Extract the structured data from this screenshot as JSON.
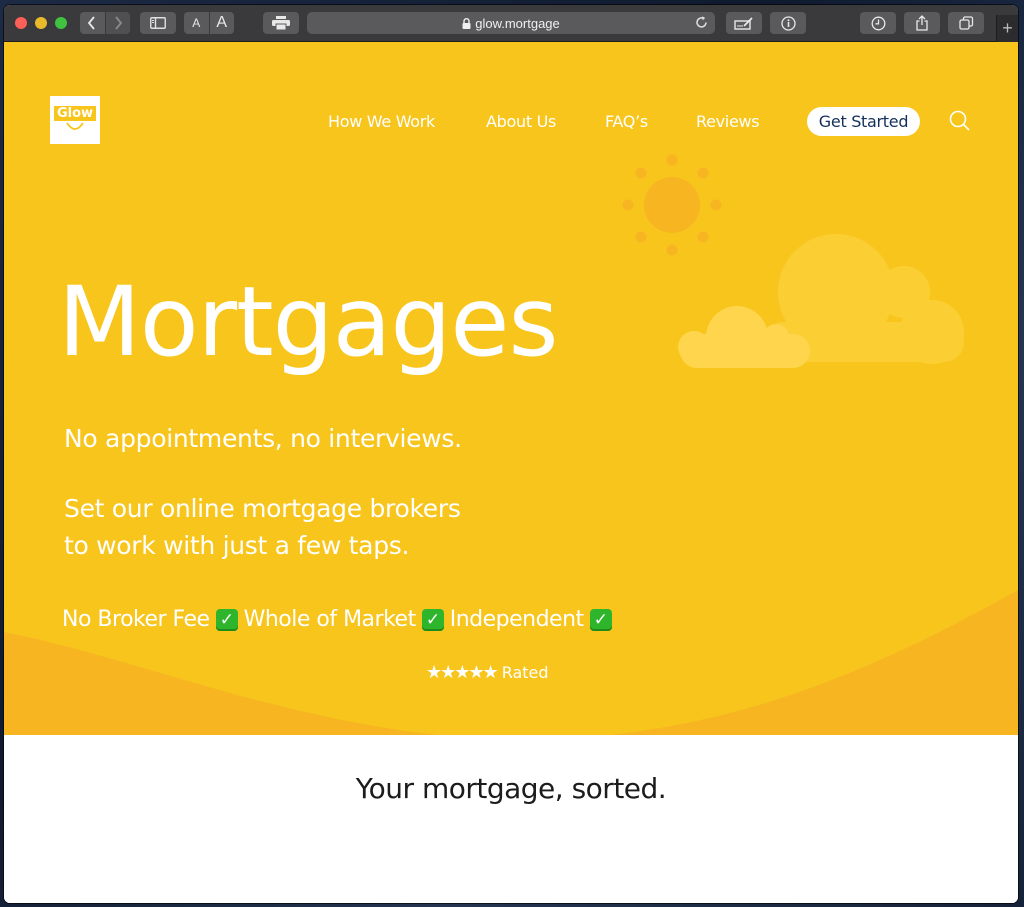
{
  "browser": {
    "url": "glow.mortgage",
    "font_small_label": "A",
    "font_large_label": "A",
    "new_tab_label": "+",
    "icons": [
      "back-icon",
      "forward-icon",
      "sidebar-icon",
      "print-icon",
      "lock-icon",
      "reload-icon",
      "annotate-icon",
      "info-icon",
      "history-icon",
      "share-icon",
      "tabs-icon"
    ]
  },
  "site": {
    "logo_text": "Glow",
    "nav": [
      {
        "label": "How We Work"
      },
      {
        "label": "About Us"
      },
      {
        "label": "FAQ’s"
      },
      {
        "label": "Reviews"
      }
    ],
    "cta_label": "Get Started",
    "hero": {
      "title": "Mortgages",
      "subtitle_line1": "No appointments, no interviews.",
      "subtitle_line2a": "Set our online mortgage brokers",
      "subtitle_line2b": "to work with just a few taps.",
      "usps": [
        {
          "label": "No Broker Fee",
          "check": "✓"
        },
        {
          "label": "Whole of Market",
          "check": "✓"
        },
        {
          "label": "Independent",
          "check": "✓"
        }
      ],
      "rating_stars": "★★★★★",
      "rating_label": "Rated"
    },
    "tagline": "Your mortgage, sorted.",
    "colors": {
      "brand_yellow": "#f8c51c",
      "wave_orange": "#f7b522",
      "cta_text": "#14305a",
      "check_green": "#2fb52c"
    }
  }
}
